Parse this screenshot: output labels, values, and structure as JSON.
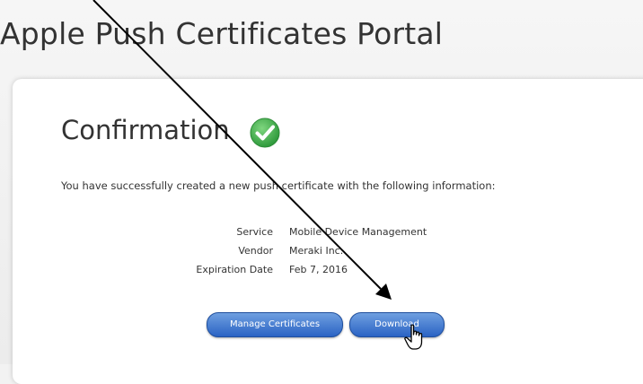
{
  "header": {
    "title": "Apple Push Certificates Portal"
  },
  "confirmation": {
    "heading": "Confirmation",
    "icon": "check-circle-icon",
    "message": "You have successfully created a new push certificate with the following information:",
    "success_color": "#3cb04a"
  },
  "info": {
    "rows": [
      {
        "label": "Service",
        "value": "Mobile Device Management"
      },
      {
        "label": "Vendor",
        "value": "Meraki Inc."
      },
      {
        "label": "Expiration Date",
        "value": "Feb 7, 2016"
      }
    ]
  },
  "buttons": {
    "manage_label": "Manage Certificates",
    "download_label": "Download",
    "accent_color": "#2a63c4"
  },
  "overlay": {
    "arrow_icon": "annotation-arrow",
    "cursor_icon": "hand-pointer-icon"
  }
}
